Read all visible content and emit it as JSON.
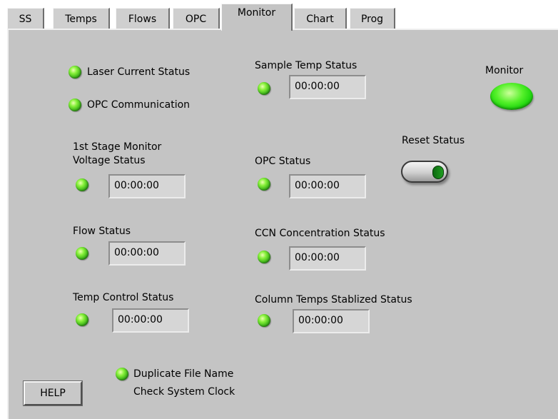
{
  "tabs": [
    "SS",
    "Temps",
    "Flows",
    "OPC",
    "Monitor",
    "Chart",
    "Prog"
  ],
  "active_tab": "Monitor",
  "indicators": {
    "laser_current": "Laser Current Status",
    "opc_communication": "OPC Communication",
    "sample_temp": {
      "label": "Sample Temp Status",
      "time": "00:00:00"
    },
    "stage_monitor": {
      "label_line1": "1st Stage Monitor",
      "label_line2": "Voltage Status",
      "time": "00:00:00"
    },
    "opc_status": {
      "label": "OPC Status",
      "time": "00:00:00"
    },
    "flow_status": {
      "label": "Flow Status",
      "time": "00:00:00"
    },
    "ccn_concentration": {
      "label": "CCN Concentration Status",
      "time": "00:00:00"
    },
    "temp_control": {
      "label": "Temp Control Status",
      "time": "00:00:00"
    },
    "column_temps": {
      "label": "Column Temps Stablized Status",
      "time": "00:00:00"
    },
    "duplicate_file": {
      "label_line1": "Duplicate File Name",
      "label_line2": "Check System Clock"
    }
  },
  "monitor": {
    "label": "Monitor"
  },
  "reset": {
    "label": "Reset Status"
  },
  "help": {
    "label": "HELP"
  },
  "colors": {
    "led_on": "#3fd01a",
    "panel_bg": "#c4c4c4",
    "tab_bg": "#cfcfcf"
  }
}
